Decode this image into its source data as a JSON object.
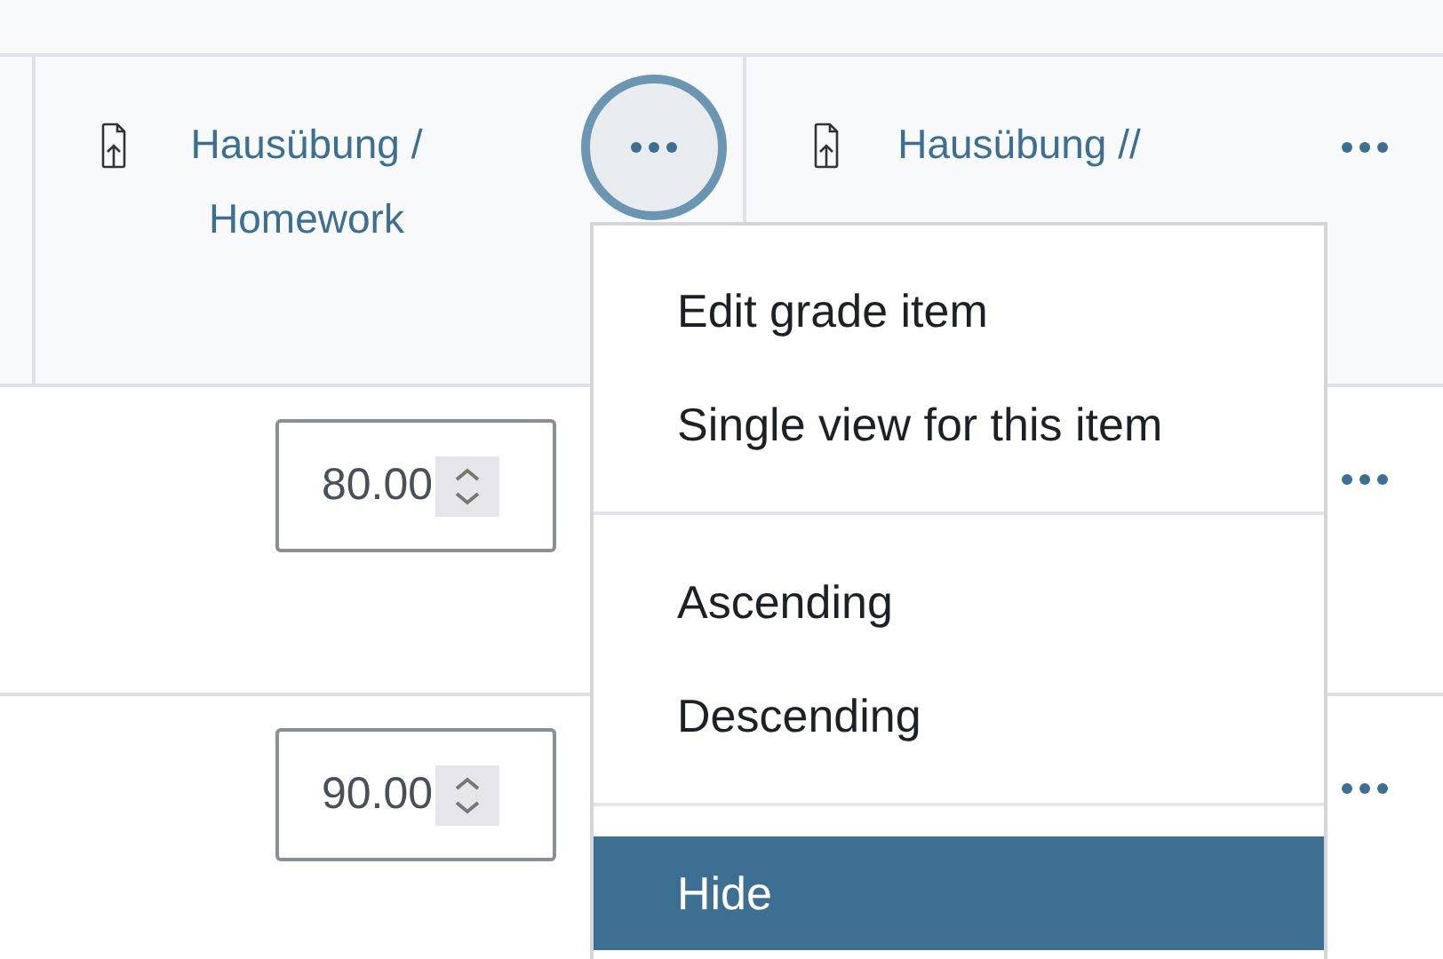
{
  "columns": [
    {
      "title": "Hausübung / Homework",
      "menu_open": true
    },
    {
      "title": "Hausübung //",
      "menu_open": false
    }
  ],
  "rows": [
    {
      "grade": "80.00"
    },
    {
      "grade": "90.00"
    }
  ],
  "menu": {
    "groups": [
      [
        {
          "label": "Edit grade item",
          "selected": false
        },
        {
          "label": "Single view for this item",
          "selected": false
        }
      ],
      [
        {
          "label": "Ascending",
          "selected": false
        },
        {
          "label": "Descending",
          "selected": false
        }
      ],
      [
        {
          "label": "Hide",
          "selected": true
        }
      ]
    ]
  }
}
